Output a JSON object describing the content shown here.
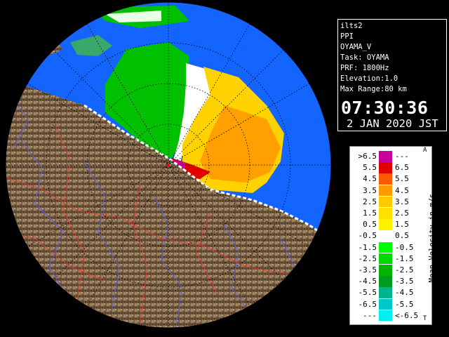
{
  "info": {
    "lines": [
      "ilts2",
      "PPI",
      "OYAMA_V",
      "Task: OYAMA",
      "PRF: 1800Hz",
      "Elevation:1.0",
      "Max Range:80 km"
    ],
    "time": "07:30:36",
    "date": "2 JAN 2020 JST"
  },
  "legend": {
    "title": "Mean Velocity in m/s",
    "corner_top": "A",
    "corner_bottom": "T",
    "rows": [
      {
        "lo": ">6.5",
        "hi": "---",
        "color": "#c8009c"
      },
      {
        "lo": "5.5",
        "hi": "6.5",
        "color": "#e00000"
      },
      {
        "lo": "4.5",
        "hi": "5.5",
        "color": "#ff5a00"
      },
      {
        "lo": "3.5",
        "hi": "4.5",
        "color": "#ff9a00"
      },
      {
        "lo": "2.5",
        "hi": "3.5",
        "color": "#ffc800"
      },
      {
        "lo": "1.5",
        "hi": "2.5",
        "color": "#ffe000"
      },
      {
        "lo": "0.5",
        "hi": "1.5",
        "color": "#fff200"
      },
      {
        "lo": "-0.5",
        "hi": "0.5",
        "color": "#ffffff"
      },
      {
        "lo": "-1.5",
        "hi": "-0.5",
        "color": "#00ff00"
      },
      {
        "lo": "-2.5",
        "hi": "-1.5",
        "color": "#00d800"
      },
      {
        "lo": "-3.5",
        "hi": "-2.5",
        "color": "#00b400"
      },
      {
        "lo": "-4.5",
        "hi": "-3.5",
        "color": "#009a1e"
      },
      {
        "lo": "-5.5",
        "hi": "-4.5",
        "color": "#00b48c"
      },
      {
        "lo": "-6.5",
        "hi": "-5.5",
        "color": "#00c8c8"
      },
      {
        "lo": "---",
        "hi": "<-6.5",
        "color": "#00f0f0"
      }
    ]
  },
  "colors": {
    "range_ring_fill": "#1464ff",
    "terrain": "#8a7050",
    "sea": "#000000"
  }
}
